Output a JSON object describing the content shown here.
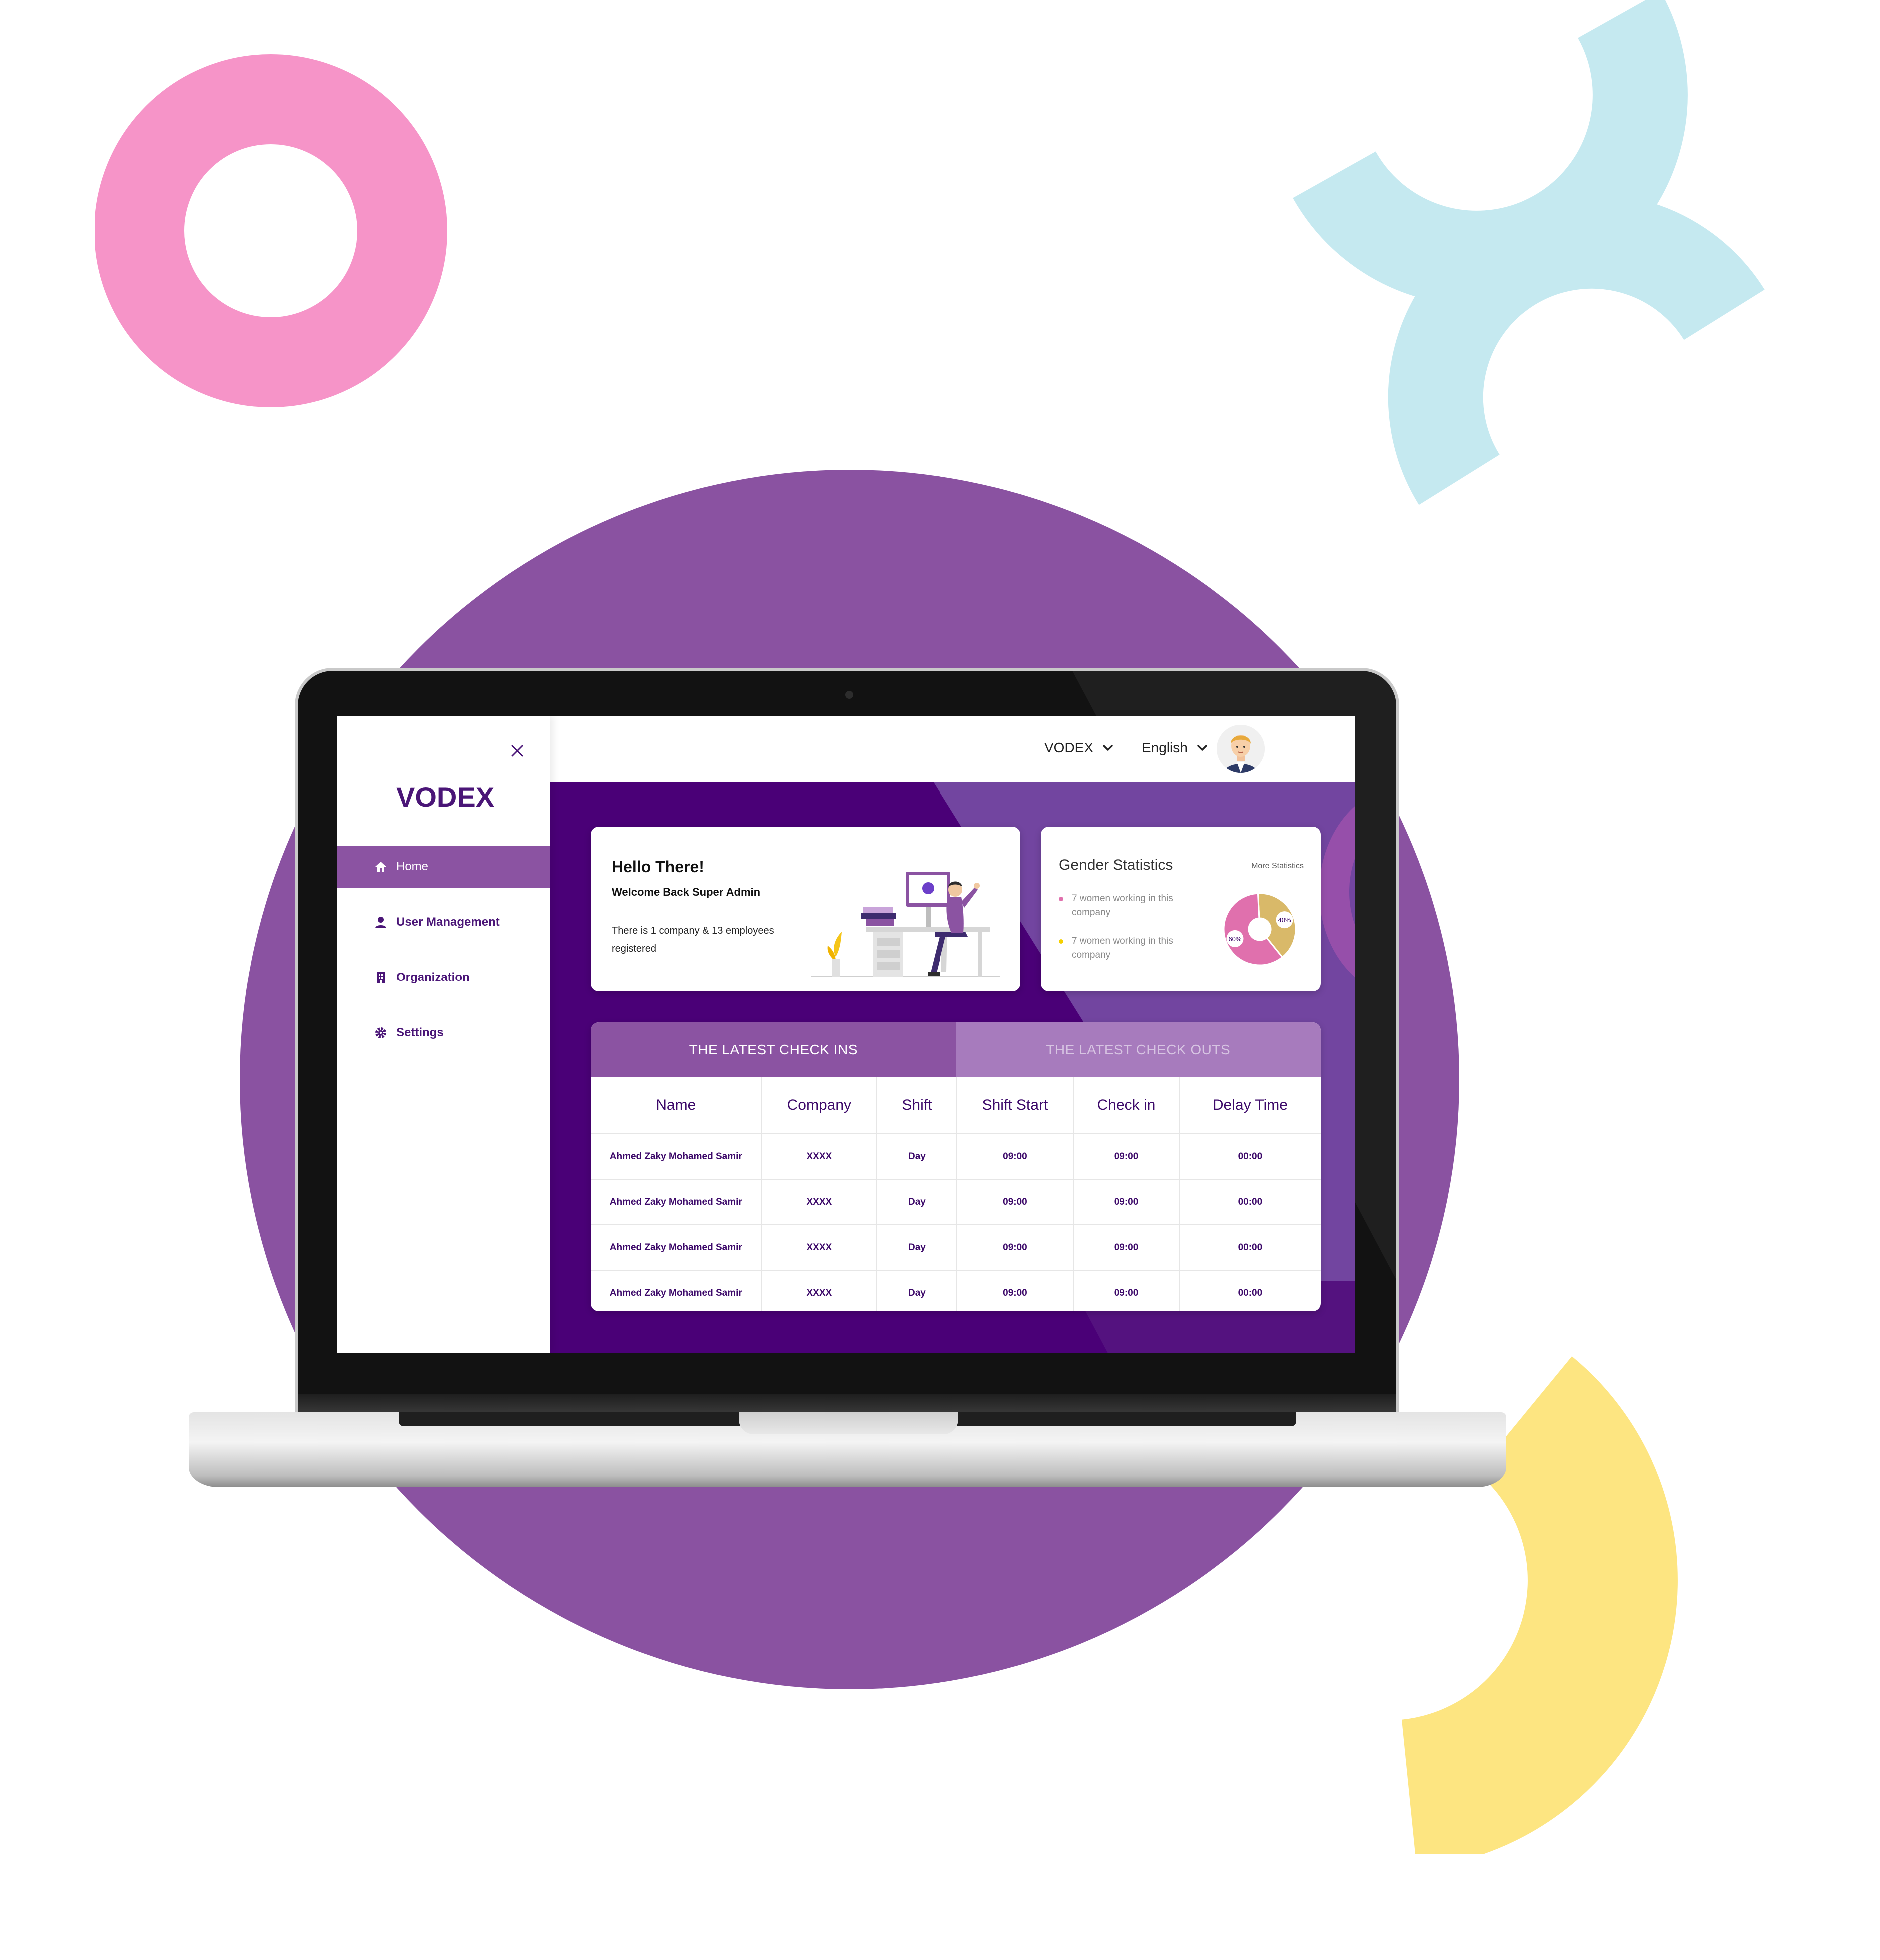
{
  "colors": {
    "accent": "#8b53a2",
    "primary_dark": "#4a0077",
    "text_purple": "#3d0a6a",
    "pink": "#f694c8",
    "cyan": "#c5e9f0",
    "yellow": "#fde581",
    "pie_female": "#e070ad",
    "pie_male": "#d9b969"
  },
  "sidebar": {
    "brand": "VODEX",
    "close_icon": "close-icon",
    "items": [
      {
        "label": "Home",
        "icon": "home-icon",
        "active": true
      },
      {
        "label": "User Management",
        "icon": "user-icon",
        "active": false
      },
      {
        "label": "Organization",
        "icon": "building-icon",
        "active": false
      },
      {
        "label": "Settings",
        "icon": "gear-icon",
        "active": false
      }
    ]
  },
  "topbar": {
    "company": "VODEX",
    "language": "English",
    "avatar_icon": "avatar"
  },
  "welcome": {
    "title": "Hello There!",
    "subtitle": "Welcome Back Super Admin",
    "description": "There is 1 company & 13 employees registered"
  },
  "gender": {
    "title": "Gender Statistics",
    "more": "More Statistics",
    "stats": [
      {
        "text": "7 women working in this company"
      },
      {
        "text": "7 women working in this company"
      }
    ]
  },
  "chart_data": {
    "type": "pie",
    "categories": [
      "60%",
      "40%"
    ],
    "values": [
      60,
      40
    ],
    "title": ""
  },
  "checks": {
    "tab_active": "THE LATEST CHECK INS",
    "tab_inactive": "THE LATEST CHECK OUTS",
    "columns": [
      "Name",
      "Company",
      "Shift",
      "Shift Start",
      "Check in",
      "Delay Time"
    ],
    "rows": [
      [
        "Ahmed Zaky Mohamed Samir",
        "XXXX",
        "Day",
        "09:00",
        "09:00",
        "00:00"
      ],
      [
        "Ahmed Zaky Mohamed Samir",
        "XXXX",
        "Day",
        "09:00",
        "09:00",
        "00:00"
      ],
      [
        "Ahmed Zaky Mohamed Samir",
        "XXXX",
        "Day",
        "09:00",
        "09:00",
        "00:00"
      ],
      [
        "Ahmed Zaky Mohamed Samir",
        "XXXX",
        "Day",
        "09:00",
        "09:00",
        "00:00"
      ]
    ]
  }
}
